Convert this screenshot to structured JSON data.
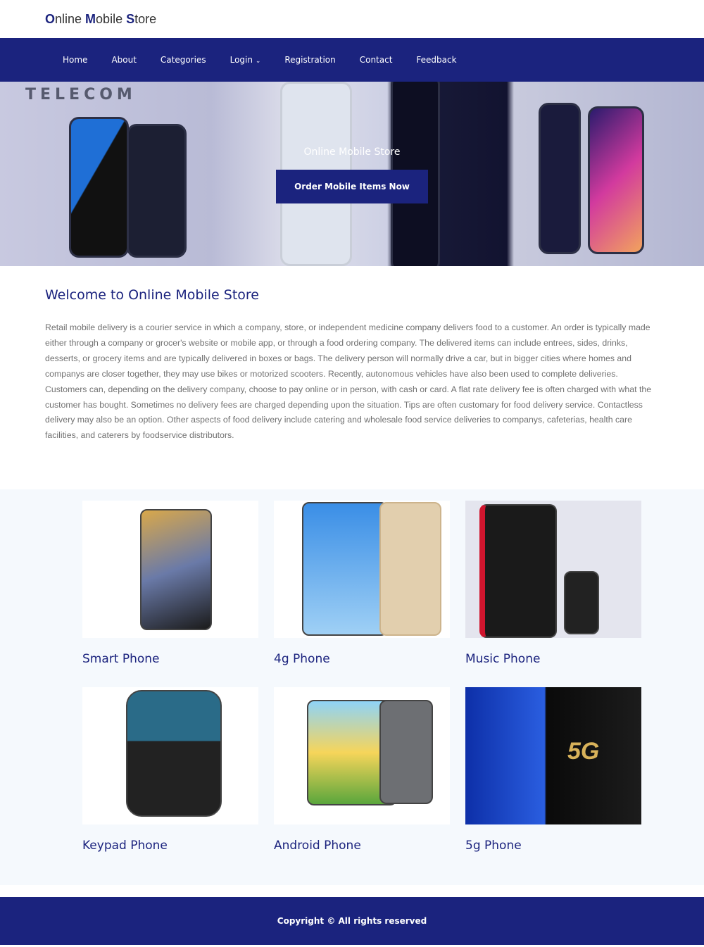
{
  "brand": {
    "o": "O",
    "nline": "nline ",
    "m": "M",
    "obile": "obile ",
    "s": "S",
    "tore": "tore"
  },
  "nav": [
    "Home",
    "About",
    "Categories",
    "Login",
    "Registration",
    "Contact",
    "Feedback"
  ],
  "hero": {
    "image_text": "TELECOM",
    "title": "Online Mobile Store",
    "button": "Order Mobile Items Now"
  },
  "welcome": {
    "title": "Welcome to Online Mobile Store",
    "body": "Retail mobile delivery is a courier service in which a company, store, or independent medicine company delivers food to a customer. An order is typically made either through a company or grocer's website or mobile app, or through a food ordering company. The delivered items can include entrees, sides, drinks, desserts, or grocery items and are typically delivered in boxes or bags. The delivery person will normally drive a car, but in bigger cities where homes and companys are closer together, they may use bikes or motorized scooters. Recently, autonomous vehicles have also been used to complete deliveries. Customers can, depending on the delivery company, choose to pay online or in person, with cash or card. A flat rate delivery fee is often charged with what the customer has bought. Sometimes no delivery fees are charged depending upon the situation. Tips are often customary for food delivery service. Contactless delivery may also be an option. Other aspects of food delivery include catering and wholesale food service deliveries to companys, cafeterias, health care facilities, and caterers by foodservice distributors."
  },
  "categories": [
    {
      "label": "Smart Phone"
    },
    {
      "label": "4g Phone"
    },
    {
      "label": "Music Phone"
    },
    {
      "label": "Keypad Phone"
    },
    {
      "label": "Android Phone"
    },
    {
      "label": "5g Phone",
      "image_text": "5G"
    }
  ],
  "footer": "Copyright © All rights reserved"
}
